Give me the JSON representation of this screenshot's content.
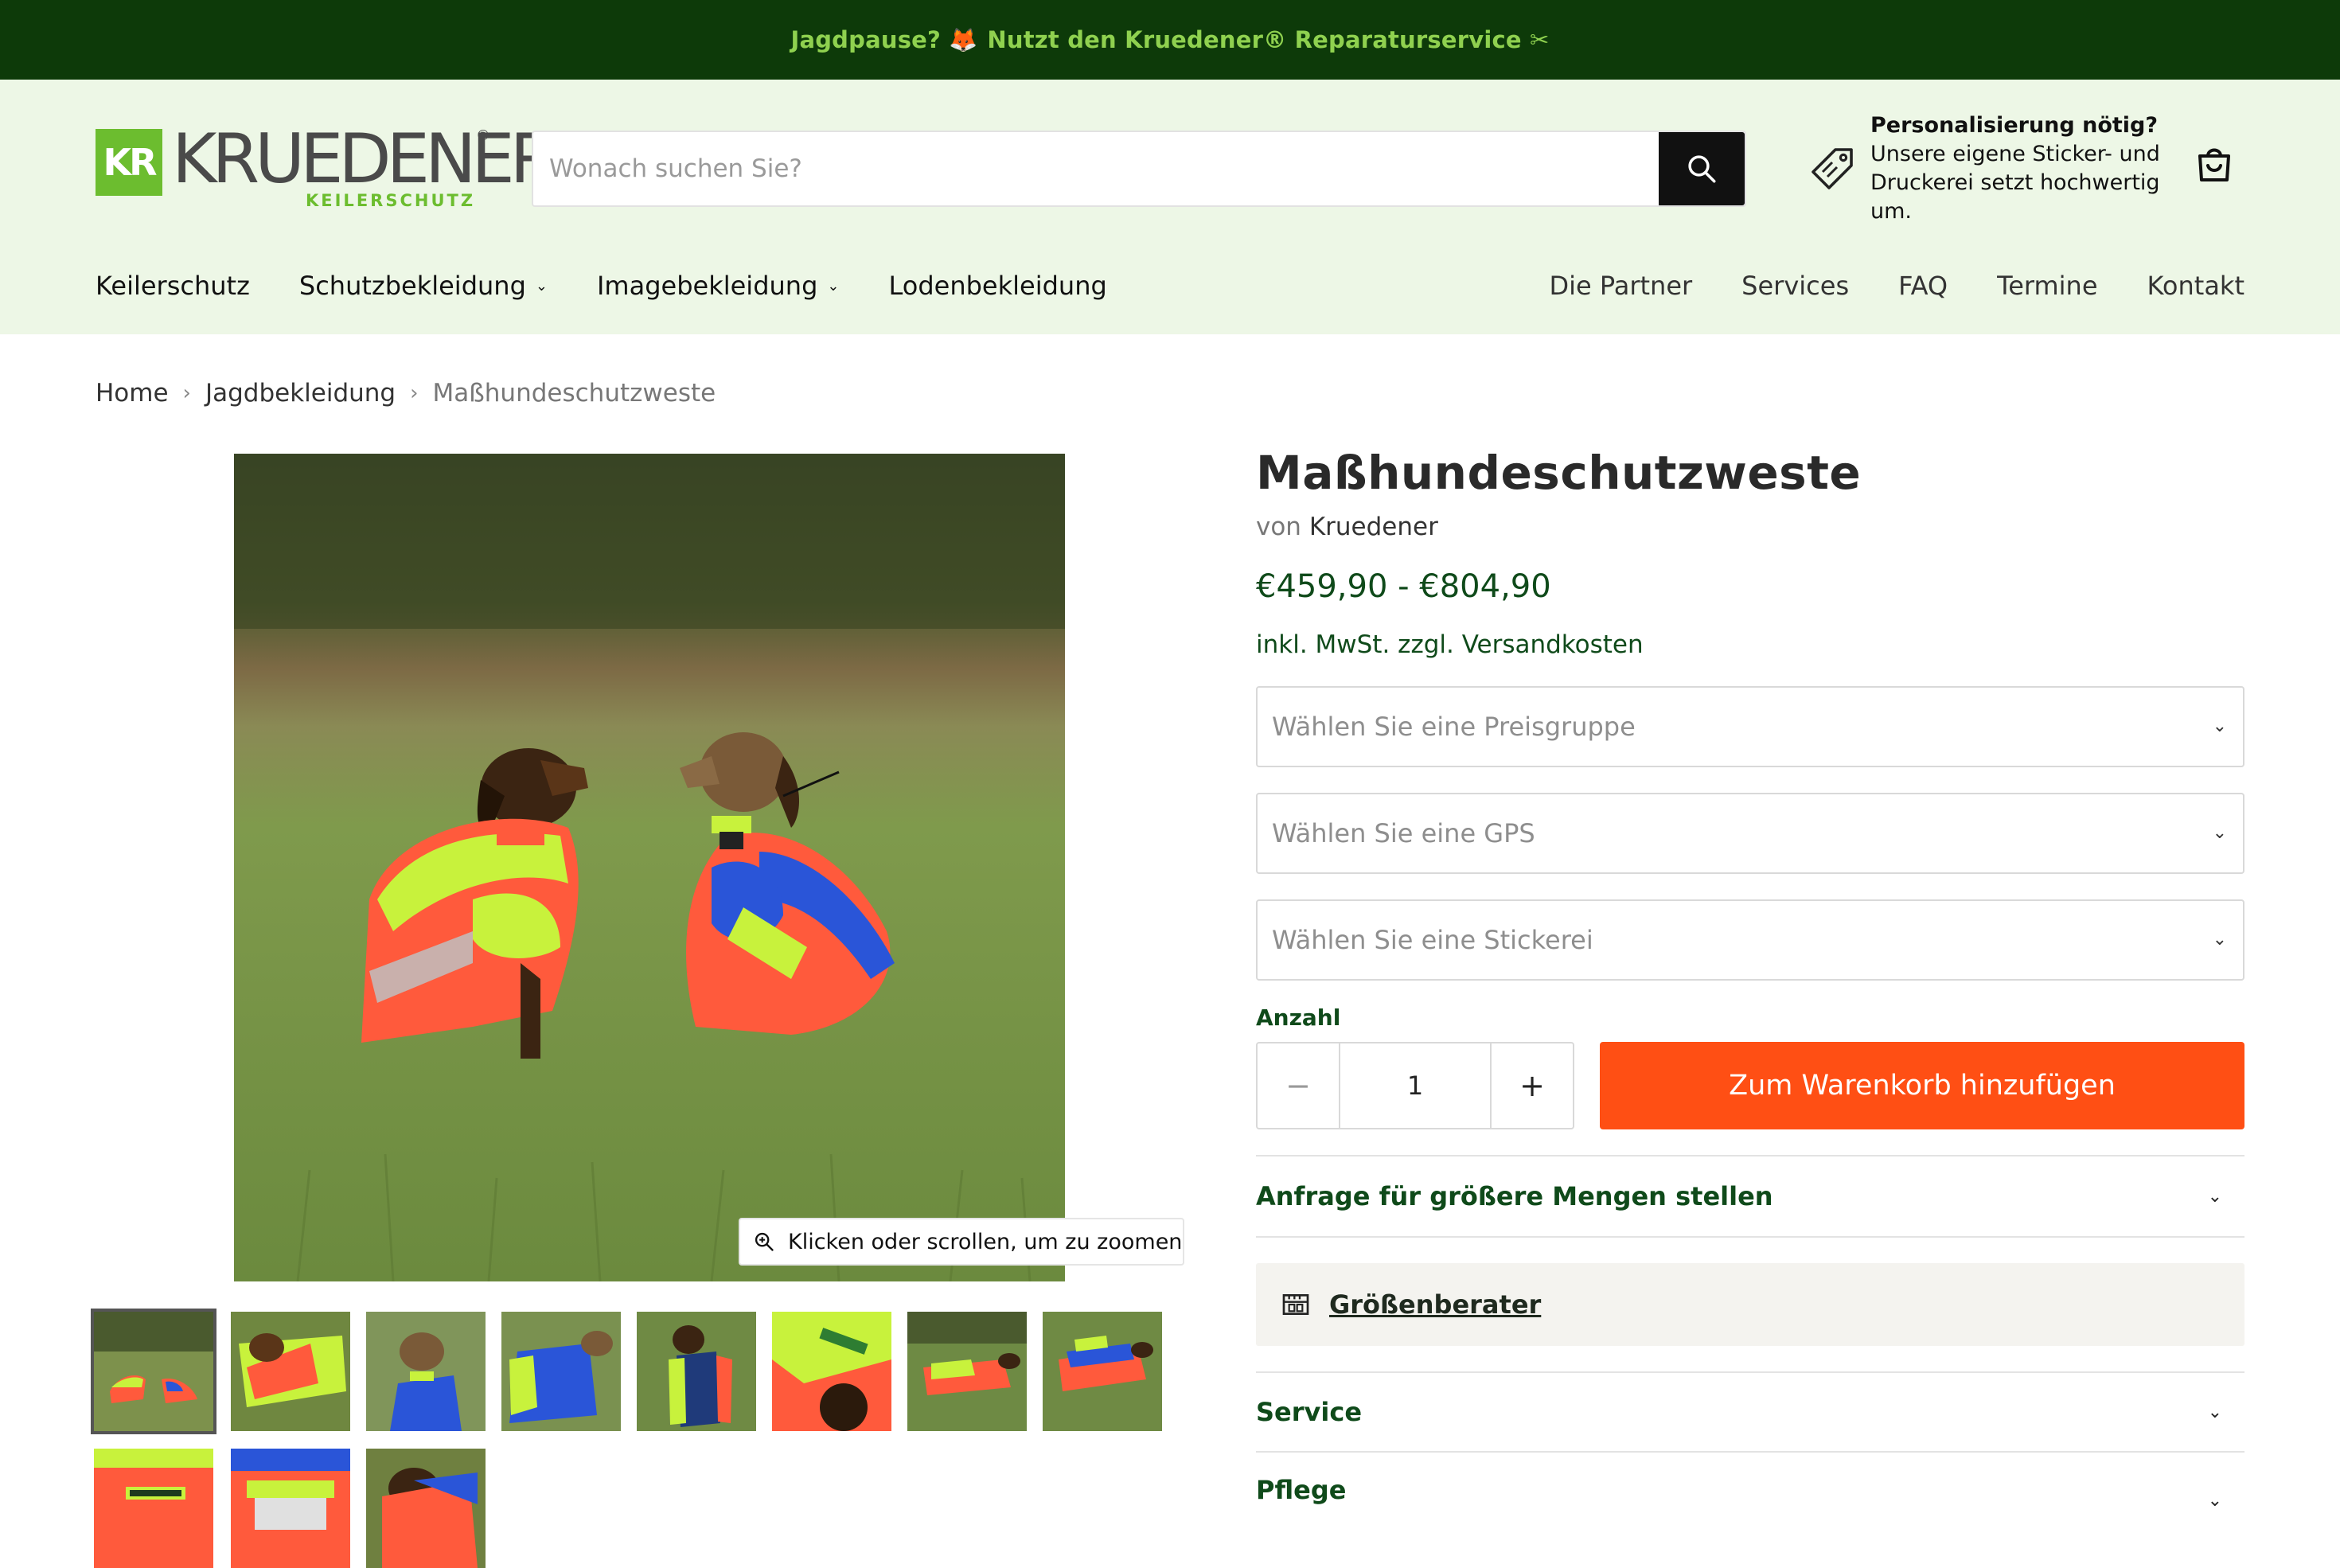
{
  "announcement": {
    "text_before": "Jagdpause?",
    "emoji": "🦊",
    "text_after": "Nutzt den Kruedener® Reparaturservice ✂"
  },
  "brand": {
    "mark": "KR",
    "wordmark": "KRUEDENER",
    "registered": "®",
    "subtitle": "KEILERSCHUTZ"
  },
  "search": {
    "placeholder": "Wonach suchen Sie?",
    "value": ""
  },
  "promo": {
    "title": "Personalisierung nötig?",
    "text": "Unsere eigene Sticker- und Druckerei setzt hochwertig um."
  },
  "nav": {
    "left": [
      {
        "label": "Keilerschutz",
        "dropdown": false
      },
      {
        "label": "Schutzbekleidung",
        "dropdown": true
      },
      {
        "label": "Imagebekleidung",
        "dropdown": true
      },
      {
        "label": "Lodenbekleidung",
        "dropdown": false
      }
    ],
    "right": [
      "Die Partner",
      "Services",
      "FAQ",
      "Termine",
      "Kontakt"
    ]
  },
  "breadcrumb": {
    "home": "Home",
    "category": "Jagdbekleidung",
    "current": "Maßhundeschutzweste"
  },
  "gallery": {
    "zoom_hint": "Klicken oder scrollen, um zu zoomen"
  },
  "product": {
    "title": "Maßhundeschutzweste",
    "vendor_prefix": "von",
    "vendor": "Kruedener",
    "price_range": "€459,90 - €804,90",
    "tax_note": "inkl. MwSt. zzgl. Versandkosten",
    "selects": [
      "Wählen Sie eine Preisgruppe",
      "Wählen Sie eine GPS",
      "Wählen Sie eine Stickerei"
    ],
    "quantity_label": "Anzahl",
    "quantity": "1",
    "minus": "−",
    "plus": "+",
    "add_to_cart": "Zum Warenkorb hinzufügen",
    "bulk_request": "Anfrage für größere Mengen stellen",
    "size_advisor": "Größenberater",
    "service": "Service",
    "care": "Pflege"
  },
  "colors": {
    "announcement_bg": "#0d3a09",
    "announcement_text": "#8fd14f",
    "header_bg": "#edf7e6",
    "accent_green": "#0f4a1a",
    "cta": "#ff4f14"
  }
}
